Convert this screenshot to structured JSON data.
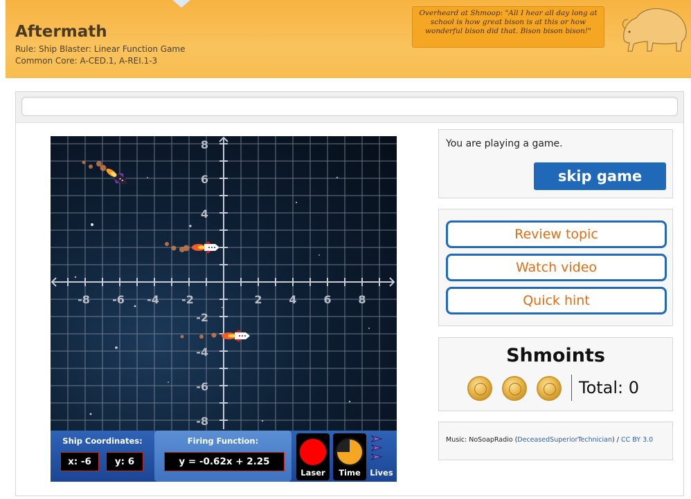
{
  "header": {
    "title": "Aftermath",
    "rule": "Rule: Ship Blaster: Linear Function Game",
    "common_core": "Common Core: A-CED.1, A-REI.1-3",
    "quote": "Overheard at Shmoop: \"All I hear all day long at school is how great bison is at this or how wonderful bison did that. Bison bison bison!\""
  },
  "game": {
    "axis_ticks_x": [
      "-8",
      "-6",
      "-4",
      "-2",
      "2",
      "4",
      "6",
      "8"
    ],
    "axis_ticks_y": [
      "8",
      "6",
      "4",
      "-2",
      "-4",
      "-6",
      "-8"
    ],
    "hud": {
      "ship_coordinates_label": "Ship Coordinates:",
      "x_value": "x: -6",
      "y_value": "y: 6",
      "firing_function_label": "Firing Function:",
      "firing_function": "y = -0.62x + 2.25",
      "laser_label": "Laser",
      "time_label": "Time",
      "lives_label": "Lives",
      "time_remaining": 0.75,
      "lives_count": 3
    },
    "colors": {
      "laser": "#ff0000",
      "timer": "#f5a623",
      "grid": "#8a94a6"
    }
  },
  "panel_play": {
    "text": "You are playing a game.",
    "skip_label": "skip game"
  },
  "panel_help": {
    "review_label": "Review topic",
    "video_label": "Watch video",
    "hint_label": "Quick hint"
  },
  "panel_points": {
    "title": "Shmoints",
    "total": "Total: 0"
  },
  "panel_music": {
    "prefix": "Music: NoSoapRadio (",
    "artist": "DeceasedSuperiorTechnician",
    "mid": ") / ",
    "license": "CC BY 3.0"
  }
}
